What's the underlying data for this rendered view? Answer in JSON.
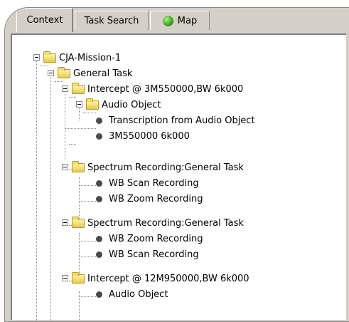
{
  "tabs": [
    {
      "label": "Context",
      "active": true
    },
    {
      "label": "Task Search",
      "active": false
    },
    {
      "label": "Map",
      "icon": "globe-icon",
      "active": false
    }
  ],
  "tree": {
    "root": "CJA-Mission-1",
    "general_task": "General Task",
    "intercept_1": "Intercept @ 3M550000,BW 6k000",
    "audio_object_1": "Audio Object",
    "transcription": "Transcription from Audio Object",
    "freq_1": "3M550000 6k000",
    "spectrum_1": "Spectrum Recording:General Task",
    "wb_scan_1": "WB Scan Recording",
    "wb_zoom_1": "WB Zoom Recording",
    "spectrum_2": "Spectrum Recording:General Task",
    "wb_zoom_2": "WB Zoom Recording",
    "wb_scan_2": "WB Scan Recording",
    "intercept_2": "Intercept @ 12M950000,BW 6k000",
    "audio_object_2": "Audio Object"
  },
  "colors": {
    "tab_bg": "#d4d0c8",
    "folder": "#e9c94a",
    "tree_line": "#8a8a8a"
  }
}
